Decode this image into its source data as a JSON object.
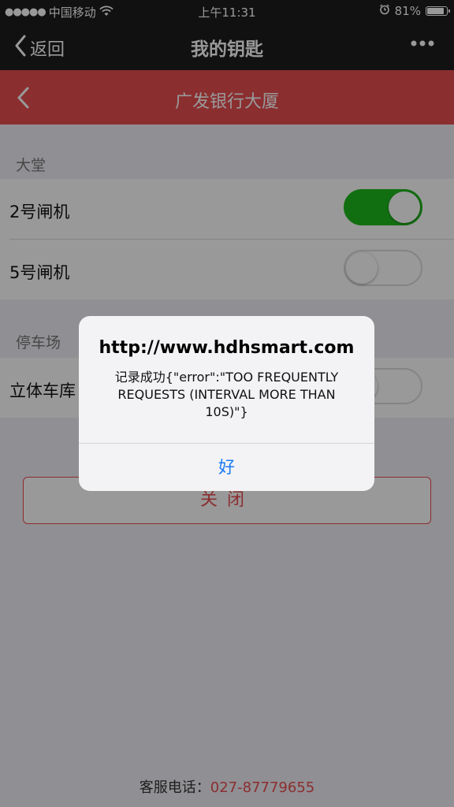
{
  "status_bar": {
    "signal_dots": "●●●●●",
    "carrier": "中国移动",
    "time": "上午11:31",
    "battery_percent": "81%",
    "battery_level": 0.81
  },
  "nav": {
    "back_label": "返回",
    "title": "我的钥匙",
    "more_icon": "ellipsis-icon"
  },
  "sub_header": {
    "title": "广发银行大厦",
    "accent_color": "#e84d50"
  },
  "sections": [
    {
      "label": "大堂",
      "items": [
        {
          "label": "2号闸机",
          "toggle_on": true
        },
        {
          "label": "5号闸机",
          "toggle_on": false
        }
      ]
    },
    {
      "label": "停车场",
      "items": [
        {
          "label": "立体车库",
          "toggle_on": false
        }
      ]
    }
  ],
  "close_button": {
    "label": "关闭"
  },
  "footer": {
    "label": "客服电话：",
    "phone": "027-87779655"
  },
  "alert": {
    "title": "http://www.hdhsmart.com",
    "message": "记录成功{\"error\":\"TOO FREQUENTLY REQUESTS (INTERVAL MORE THAN 10S)\"}",
    "button_label": "好"
  },
  "colors": {
    "toggle_on": "#1fb91d",
    "alert_button": "#1a7bf5"
  }
}
